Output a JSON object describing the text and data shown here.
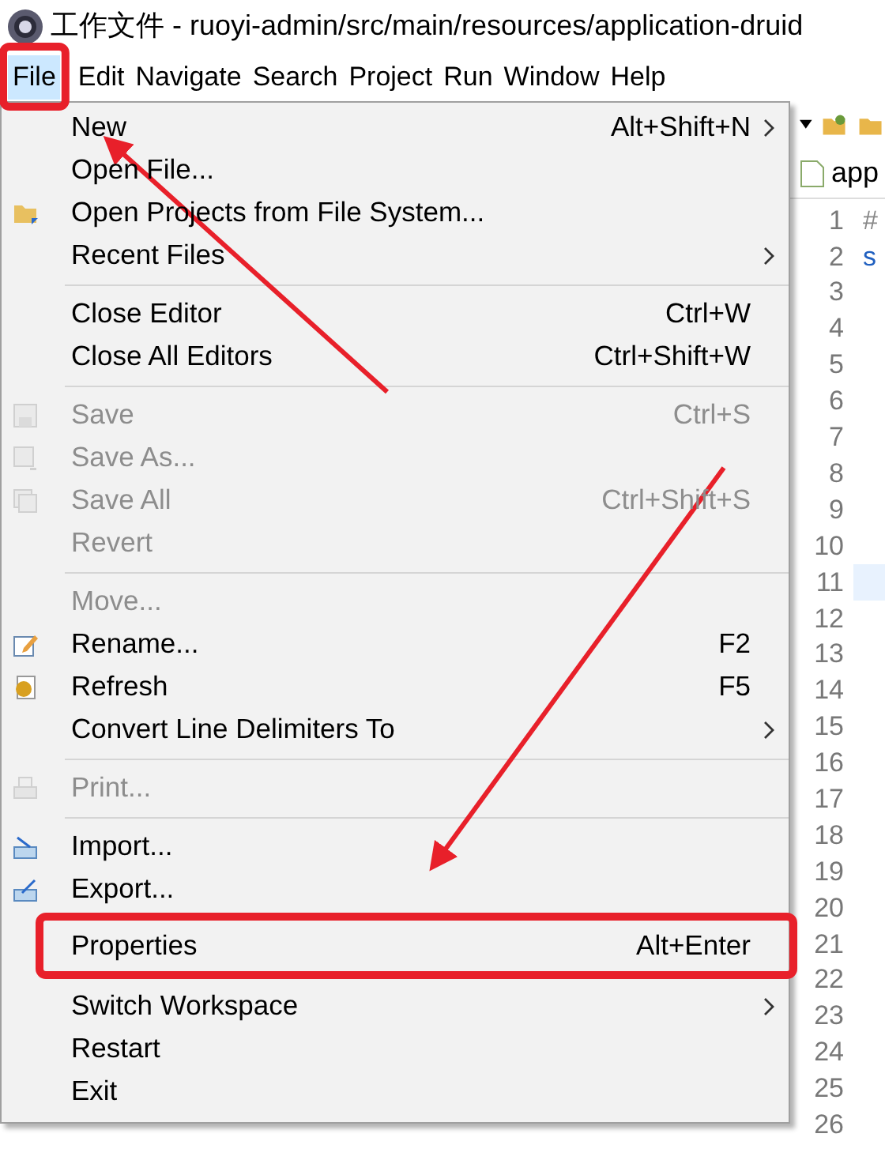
{
  "window": {
    "title": "工作文件 - ruoyi-admin/src/main/resources/application-druid"
  },
  "menubar": [
    {
      "label": "File",
      "selected": true,
      "annotated": true
    },
    {
      "label": "Edit",
      "selected": false,
      "annotated": false
    },
    {
      "label": "Navigate",
      "selected": false,
      "annotated": false
    },
    {
      "label": "Search",
      "selected": false,
      "annotated": false
    },
    {
      "label": "Project",
      "selected": false,
      "annotated": false
    },
    {
      "label": "Run",
      "selected": false,
      "annotated": false
    },
    {
      "label": "Window",
      "selected": false,
      "annotated": false
    },
    {
      "label": "Help",
      "selected": false,
      "annotated": false
    }
  ],
  "file_menu": [
    {
      "kind": "plain",
      "label": "New",
      "shortcut": "Alt+Shift+N",
      "submenu": true,
      "disabled": false,
      "annotated": false
    },
    {
      "kind": "plain",
      "label": "Open File...",
      "submenu": false,
      "disabled": false,
      "annotated": false
    },
    {
      "kind": "folder",
      "label": "Open Projects from File System...",
      "submenu": false,
      "disabled": false,
      "annotated": false
    },
    {
      "kind": "plain",
      "label": "Recent Files",
      "submenu": true,
      "disabled": false,
      "annotated": false
    },
    {
      "kind": "separator"
    },
    {
      "kind": "plain",
      "label": "Close Editor",
      "shortcut": "Ctrl+W",
      "submenu": false,
      "disabled": false,
      "annotated": false
    },
    {
      "kind": "plain",
      "label": "Close All Editors",
      "shortcut": "Ctrl+Shift+W",
      "submenu": false,
      "disabled": false,
      "annotated": false
    },
    {
      "kind": "separator"
    },
    {
      "kind": "save",
      "label": "Save",
      "shortcut": "Ctrl+S",
      "submenu": false,
      "disabled": true,
      "annotated": false
    },
    {
      "kind": "save-as",
      "label": "Save As...",
      "submenu": false,
      "disabled": true,
      "annotated": false
    },
    {
      "kind": "save-all",
      "label": "Save All",
      "shortcut": "Ctrl+Shift+S",
      "submenu": false,
      "disabled": true,
      "annotated": false
    },
    {
      "kind": "plain",
      "label": "Revert",
      "submenu": false,
      "disabled": true,
      "annotated": false
    },
    {
      "kind": "separator"
    },
    {
      "kind": "plain",
      "label": "Move...",
      "submenu": false,
      "disabled": true,
      "annotated": false
    },
    {
      "kind": "rename",
      "label": "Rename...",
      "shortcut": "F2",
      "submenu": false,
      "disabled": false,
      "annotated": false
    },
    {
      "kind": "refresh",
      "label": "Refresh",
      "shortcut": "F5",
      "submenu": false,
      "disabled": false,
      "annotated": false
    },
    {
      "kind": "plain",
      "label": "Convert Line Delimiters To",
      "submenu": true,
      "disabled": false,
      "annotated": false
    },
    {
      "kind": "separator"
    },
    {
      "kind": "print",
      "label": "Print...",
      "submenu": false,
      "disabled": true,
      "annotated": false
    },
    {
      "kind": "separator"
    },
    {
      "kind": "import",
      "label": "Import...",
      "submenu": false,
      "disabled": false,
      "annotated": false
    },
    {
      "kind": "export",
      "label": "Export...",
      "submenu": false,
      "disabled": false,
      "annotated": false
    },
    {
      "kind": "plain",
      "label": "Properties",
      "shortcut": "Alt+Enter",
      "submenu": false,
      "disabled": false,
      "annotated": true
    },
    {
      "kind": "plain",
      "label": "Switch Workspace",
      "submenu": true,
      "disabled": false,
      "annotated": false
    },
    {
      "kind": "plain",
      "label": "Restart",
      "submenu": false,
      "disabled": false,
      "annotated": false
    },
    {
      "kind": "plain",
      "label": "Exit",
      "submenu": false,
      "disabled": false,
      "annotated": false
    }
  ],
  "editor": {
    "tab": {
      "label": "app"
    },
    "lines": [
      {
        "number": "1",
        "text": "#",
        "current": false
      },
      {
        "number": "2",
        "text": "s",
        "current": false
      },
      {
        "number": "3",
        "current": false
      },
      {
        "number": "4",
        "current": false
      },
      {
        "number": "5",
        "current": false
      },
      {
        "number": "6",
        "current": false
      },
      {
        "number": "7",
        "current": false
      },
      {
        "number": "8",
        "current": false
      },
      {
        "number": "9",
        "current": false
      },
      {
        "number": "10",
        "current": false
      },
      {
        "number": "11",
        "current": true
      },
      {
        "number": "12",
        "current": false
      },
      {
        "number": "13",
        "current": false
      },
      {
        "number": "14",
        "current": false
      },
      {
        "number": "15",
        "current": false
      },
      {
        "number": "16",
        "current": false
      },
      {
        "number": "17",
        "current": false
      },
      {
        "number": "18",
        "current": false
      },
      {
        "number": "19",
        "current": false
      },
      {
        "number": "20",
        "current": false
      },
      {
        "number": "21",
        "current": false
      },
      {
        "number": "22",
        "current": false
      },
      {
        "number": "23",
        "current": false
      },
      {
        "number": "24",
        "current": false
      },
      {
        "number": "25",
        "current": false
      },
      {
        "number": "26",
        "current": false
      }
    ]
  }
}
